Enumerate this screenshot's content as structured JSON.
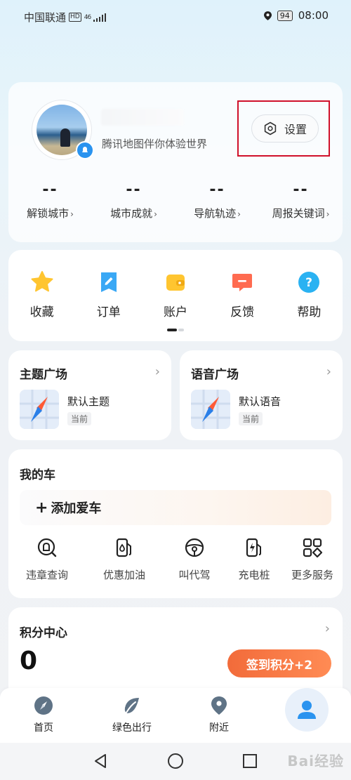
{
  "status_bar": {
    "carrier": "中国联通",
    "network_badge": "HD",
    "signal": "46",
    "battery": "94",
    "time": "08:00"
  },
  "profile": {
    "slogan": "腾讯地图伴你体验世界",
    "settings_label": "设置",
    "stats": [
      {
        "value": "--",
        "label": "解锁城市"
      },
      {
        "value": "--",
        "label": "城市成就"
      },
      {
        "value": "--",
        "label": "导航轨迹"
      },
      {
        "value": "--",
        "label": "周报关键词"
      }
    ]
  },
  "quick_actions": [
    {
      "label": "收藏",
      "icon": "star-icon"
    },
    {
      "label": "订单",
      "icon": "order-icon"
    },
    {
      "label": "账户",
      "icon": "wallet-icon"
    },
    {
      "label": "反馈",
      "icon": "feedback-icon"
    },
    {
      "label": "帮助",
      "icon": "help-icon"
    }
  ],
  "theme_square": {
    "title": "主题广场",
    "item": "默认主题",
    "tag": "当前"
  },
  "voice_square": {
    "title": "语音广场",
    "item": "默认语音",
    "tag": "当前"
  },
  "my_car": {
    "title": "我的车",
    "add_label": "添加爱车",
    "services": [
      {
        "label": "违章查询",
        "icon": "violation-icon"
      },
      {
        "label": "优惠加油",
        "icon": "fuel-icon"
      },
      {
        "label": "叫代驾",
        "icon": "steering-wheel-icon"
      },
      {
        "label": "充电桩",
        "icon": "charging-icon"
      },
      {
        "label": "更多服务",
        "icon": "more-services-icon"
      }
    ]
  },
  "points": {
    "title": "积分中心",
    "value": "0",
    "signin_label": "签到积分+2"
  },
  "tabs": [
    {
      "label": "首页",
      "icon": "compass-icon"
    },
    {
      "label": "绿色出行",
      "icon": "leaf-icon"
    },
    {
      "label": "附近",
      "icon": "location-pin-icon"
    }
  ],
  "watermark": "Bai经验",
  "colors": {
    "accent_orange": "#f26b3a",
    "settings_highlight": "#d0102a",
    "brand_blue": "#2a93ef"
  }
}
